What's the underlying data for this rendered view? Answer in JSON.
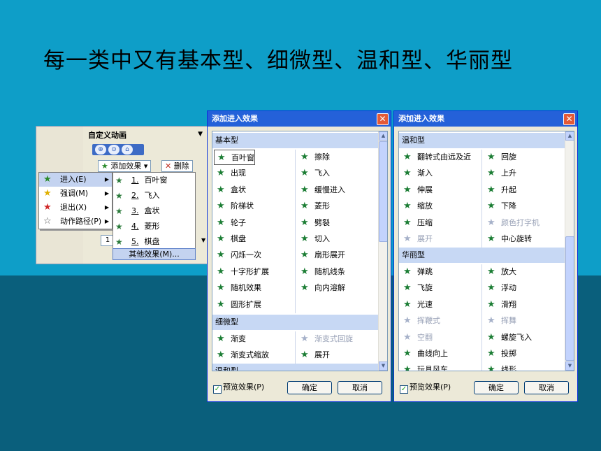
{
  "heading": "每一类中又有基本型、细微型、温和型、华丽型",
  "pane": {
    "title": "自定义动画",
    "title_dd": "▼",
    "nav_icons": [
      "⊕",
      "⊙",
      "⌂"
    ],
    "add_effect": "添加效果 ▾",
    "delete": "删除",
    "field_value": "1",
    "menu": [
      {
        "label": "进入(E)",
        "icon": "★",
        "icon_color": "#2a8a2a",
        "arrow": "▶"
      },
      {
        "label": "强调(M)",
        "icon": "★",
        "icon_color": "#e0b000",
        "arrow": "▶"
      },
      {
        "label": "退出(X)",
        "icon": "★",
        "icon_color": "#d02828",
        "arrow": "▶"
      },
      {
        "label": "动作路径(P)",
        "icon": "☆",
        "icon_color": "#555555",
        "arrow": "▶"
      }
    ],
    "submenu": [
      {
        "key": "1.",
        "label": "百叶窗"
      },
      {
        "key": "2.",
        "label": "飞入"
      },
      {
        "key": "3.",
        "label": "盒状"
      },
      {
        "key": "4.",
        "label": "菱形"
      },
      {
        "key": "5.",
        "label": "棋盘"
      }
    ],
    "more_effects": "其他效果(M)..."
  },
  "dialog1": {
    "title": "添加进入效果",
    "close": "✕",
    "sections": [
      "基本型",
      "细微型",
      "温和型"
    ],
    "basic_col1": [
      "百叶窗",
      "出现",
      "盒状",
      "阶梯状",
      "轮子",
      "棋盘",
      "闪烁一次",
      "十字形扩展",
      "随机效果",
      "圆形扩展"
    ],
    "basic_col2": [
      "擦除",
      "飞入",
      "缓慢进入",
      "菱形",
      "劈裂",
      "切入",
      "扇形展开",
      "随机线条",
      "向内溶解"
    ],
    "subtle_col1": [
      "渐变",
      "渐变式缩放"
    ],
    "subtle_col2": [
      "渐变式回旋",
      "展开"
    ],
    "preview": "预览效果(P)",
    "ok": "确定",
    "cancel": "取消"
  },
  "dialog2": {
    "title": "添加进入效果",
    "close": "✕",
    "sections": [
      "温和型",
      "华丽型"
    ],
    "mild_col1": [
      "翻转式由远及近",
      "渐入",
      "伸展",
      "缩放",
      "压缩",
      "展开"
    ],
    "mild_col2": [
      "回旋",
      "上升",
      "升起",
      "下降",
      "颜色打字机",
      "中心旋转"
    ],
    "fancy_col1": [
      "弹跳",
      "飞旋",
      "光速",
      "挥鞭式",
      "空翻",
      "曲线向上",
      "玩具风车"
    ],
    "fancy_col2": [
      "放大",
      "浮动",
      "滑翔",
      "挥舞",
      "螺旋飞入",
      "投掷",
      "线形"
    ],
    "preview": "预览效果(P)",
    "ok": "确定",
    "cancel": "取消"
  },
  "icons": {
    "effect": "effect-star-icon",
    "check": "✓",
    "scroll_up": "▲",
    "scroll_down": "▼"
  }
}
